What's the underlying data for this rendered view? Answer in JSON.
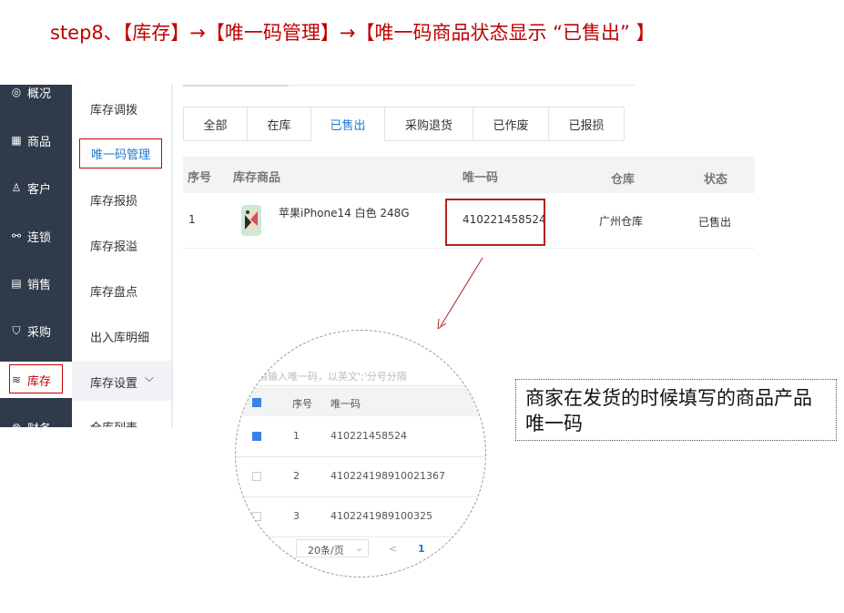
{
  "title": "step8、【库存】→【唯一码管理】→【唯一码商品状态显示 “已售出” 】",
  "sidebar": {
    "items": [
      {
        "icon": "compass-icon",
        "label": "概况"
      },
      {
        "icon": "grid-icon",
        "label": "商品"
      },
      {
        "icon": "user-icon",
        "label": "客户"
      },
      {
        "icon": "link-icon",
        "label": "连锁"
      },
      {
        "icon": "document-icon",
        "label": "销售"
      },
      {
        "icon": "cart-icon",
        "label": "采购"
      },
      {
        "icon": "layers-icon",
        "label": "库存"
      },
      {
        "icon": "finance-icon",
        "label": "财务"
      }
    ]
  },
  "submenu": {
    "items": [
      "库存调拨",
      "唯一码管理",
      "库存报损",
      "库存报溢",
      "库存盘点",
      "出入库明细"
    ],
    "group": "库存设置",
    "after": "仓库列表"
  },
  "tabs": [
    "全部",
    "在库",
    "已售出",
    "采购退货",
    "已作废",
    "已报损"
  ],
  "active_tab": "已售出",
  "table": {
    "headers": [
      "序号",
      "库存商品",
      "唯一码",
      "仓库",
      "状态"
    ],
    "rows": [
      {
        "index": "1",
        "product": "苹果iPhone14 白色 248G",
        "code": "410221458524",
        "warehouse": "广州仓库",
        "status": "已售出"
      }
    ]
  },
  "zoom": {
    "placeholder": "请输入唯一码，以英文';'分号分隔",
    "headers": [
      "序号",
      "唯一码"
    ],
    "rows": [
      {
        "index": "1",
        "code": "410221458524",
        "checked": true
      },
      {
        "index": "2",
        "code": "410224198910021367",
        "checked": false
      },
      {
        "index": "3",
        "code": "4102241989100325",
        "checked": false
      }
    ],
    "total_prefix": "条",
    "page_size": "20条/页",
    "prev": "<",
    "page": "1"
  },
  "note": "商家在发货的时候填写的商品产品唯一码"
}
